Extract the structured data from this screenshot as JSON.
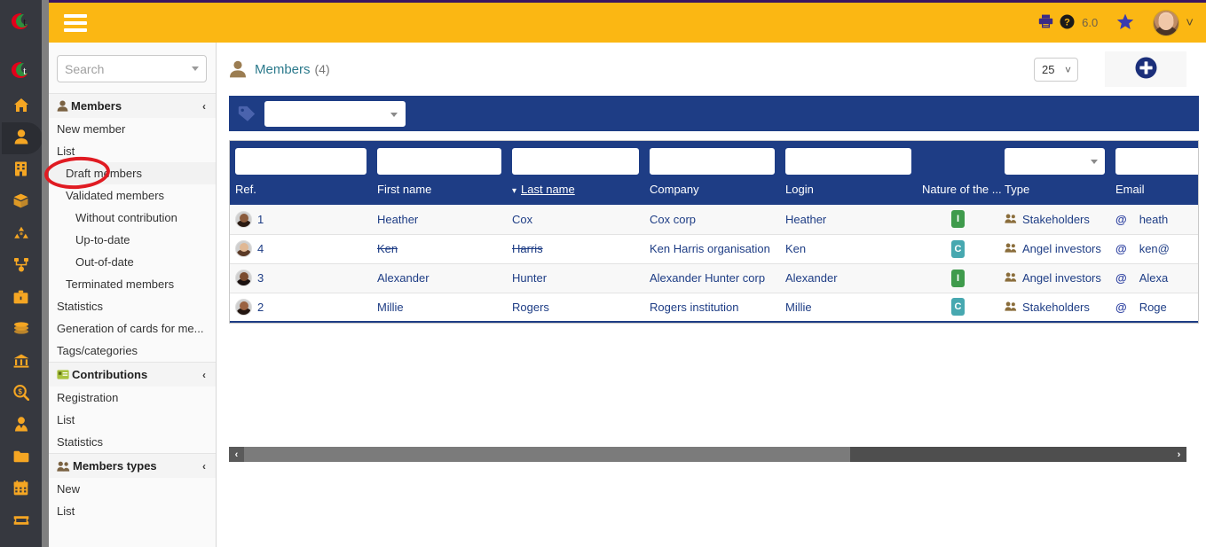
{
  "topbar": {
    "menu_icon": "hamburger-icon",
    "print_icon": "printer-icon",
    "help_icon": "question-circle-icon",
    "version": "6.0",
    "star_icon": "star-icon",
    "avatar_icon": "user-avatar",
    "chevron": "˅"
  },
  "rail": {
    "logo": "app-logo",
    "items": [
      {
        "name": "logo-secondary",
        "icon": "logo-icon"
      },
      {
        "name": "home",
        "icon": "home-icon"
      },
      {
        "name": "members",
        "icon": "user-icon",
        "active": true
      },
      {
        "name": "third-parties",
        "icon": "building-icon"
      },
      {
        "name": "products",
        "icon": "box-icon"
      },
      {
        "name": "mrp",
        "icon": "recycle-icon"
      },
      {
        "name": "projects",
        "icon": "project-share-icon"
      },
      {
        "name": "commercial",
        "icon": "briefcase-icon"
      },
      {
        "name": "billing",
        "icon": "money-stack-icon"
      },
      {
        "name": "accounting",
        "icon": "bank-icon"
      },
      {
        "name": "expense-report",
        "icon": "search-dollar-icon"
      },
      {
        "name": "hrm",
        "icon": "user-tie-icon"
      },
      {
        "name": "documents",
        "icon": "folder-icon"
      },
      {
        "name": "agenda",
        "icon": "calendar-icon"
      },
      {
        "name": "ticket",
        "icon": "ticket-icon"
      }
    ]
  },
  "sidebar": {
    "search": {
      "placeholder": "Search",
      "value": "",
      "caret_icon": "caret-down-icon"
    },
    "groups": [
      {
        "title": "Members",
        "icon": "user-icon",
        "chevron": "‹",
        "items": [
          {
            "label": "New member",
            "level": 1
          },
          {
            "label": "List",
            "level": 1,
            "highlighted": true
          },
          {
            "label": "Draft members",
            "level": 2,
            "shaded": true
          },
          {
            "label": "Validated members",
            "level": 2
          },
          {
            "label": "Without contribution",
            "level": 3
          },
          {
            "label": "Up-to-date",
            "level": 3
          },
          {
            "label": "Out-of-date",
            "level": 3
          },
          {
            "label": "Terminated members",
            "level": 2
          },
          {
            "label": "Statistics",
            "level": 1
          },
          {
            "label": "Generation of cards for me...",
            "level": 1
          },
          {
            "label": "Tags/categories",
            "level": 1
          }
        ]
      },
      {
        "title": "Contributions",
        "icon": "card-icon",
        "chevron": "‹",
        "items": [
          {
            "label": "Registration",
            "level": 1
          },
          {
            "label": "List",
            "level": 1
          },
          {
            "label": "Statistics",
            "level": 1
          }
        ]
      },
      {
        "title": "Members types",
        "icon": "users-icon",
        "chevron": "‹",
        "items": [
          {
            "label": "New",
            "level": 1
          },
          {
            "label": "List",
            "level": 1
          }
        ]
      }
    ]
  },
  "page": {
    "icon": "user-icon",
    "title": "Members",
    "count": "(4)",
    "rows_per_page": "25",
    "rows_chevron": "˅",
    "add_button_icon": "plus-circle-icon"
  },
  "tagbar": {
    "icon": "tag-icon",
    "select_value": "",
    "caret_icon": "caret-down-icon"
  },
  "table": {
    "columns": [
      {
        "key": "ref",
        "label": "Ref.",
        "filter": "input",
        "filter_value": "",
        "sorted": false
      },
      {
        "key": "firstname",
        "label": "First name",
        "filter": "input",
        "filter_value": "",
        "sorted": false
      },
      {
        "key": "lastname",
        "label": "Last name",
        "filter": "input",
        "filter_value": "",
        "sorted": true,
        "sort_dir": "desc",
        "sort_arrow": "▾"
      },
      {
        "key": "company",
        "label": "Company",
        "filter": "input",
        "filter_value": "",
        "sorted": false
      },
      {
        "key": "login",
        "label": "Login",
        "filter": "input",
        "filter_value": "",
        "sorted": false
      },
      {
        "key": "nature",
        "label": "Nature of the ...",
        "filter": "none",
        "sorted": false
      },
      {
        "key": "type",
        "label": "Type",
        "filter": "select",
        "filter_value": "",
        "sorted": false
      },
      {
        "key": "email",
        "label": "Email",
        "filter": "input",
        "filter_value": "",
        "sorted": false
      }
    ],
    "rows": [
      {
        "ref": "1",
        "firstname": "Heather",
        "lastname": "Cox",
        "company": "Cox corp",
        "login": "Heather",
        "nature": "I",
        "nature_class": "nature-I",
        "type": "Stakeholders",
        "email": "heath",
        "struck": false,
        "avatar": "woman-dark-avatar",
        "avatar_skin": "#8a5a3b",
        "avatar_hair": "#2a1a12"
      },
      {
        "ref": "4",
        "firstname": "Ken",
        "lastname": "Harris",
        "company": "Ken Harris organisation",
        "login": "Ken",
        "nature": "C",
        "nature_class": "nature-C",
        "type": "Angel investors",
        "email": "ken@",
        "struck": true,
        "avatar": "man-beard-avatar",
        "avatar_skin": "#e0b894",
        "avatar_hair": "#5b3a26"
      },
      {
        "ref": "3",
        "firstname": "Alexander",
        "lastname": "Hunter",
        "company": "Alexander Hunter corp",
        "login": "Alexander",
        "nature": "I",
        "nature_class": "nature-I",
        "type": "Angel investors",
        "email": "Alexa",
        "struck": false,
        "avatar": "man-dark-avatar",
        "avatar_skin": "#7a4c30",
        "avatar_hair": "#1b1110"
      },
      {
        "ref": "2",
        "firstname": "Millie",
        "lastname": "Rogers",
        "company": "Rogers institution",
        "login": "Millie",
        "nature": "C",
        "nature_class": "nature-C",
        "type": "Stakeholders",
        "email": "Roge",
        "struck": false,
        "avatar": "woman-avatar",
        "avatar_skin": "#9a6241",
        "avatar_hair": "#241712"
      }
    ]
  },
  "scrollbar": {
    "left_arrow": "‹",
    "right_arrow": "›"
  },
  "colors": {
    "topbar": "#fbb713",
    "header_blue": "#1e3d85",
    "rail": "#36383f",
    "link_blue": "#1e3d85",
    "title_teal": "#2c7a8c",
    "annotation_red": "#e01b22",
    "nature_individual": "#3f9b4c",
    "nature_company": "#47a8b0"
  }
}
